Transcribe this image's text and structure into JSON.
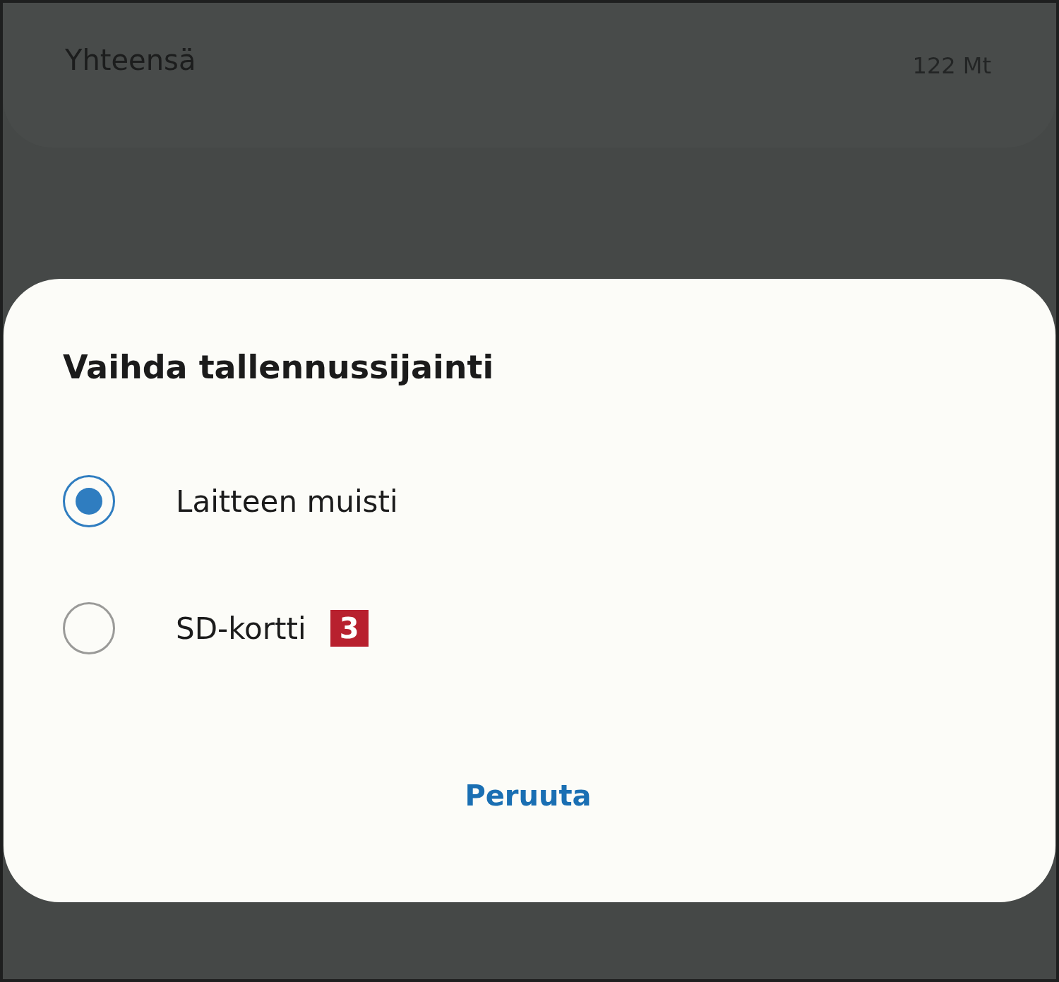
{
  "summary": {
    "label": "Yhteensä",
    "value": "122 Mt"
  },
  "dialog": {
    "title": "Vaihda tallennussijainti",
    "options": [
      {
        "label": "Laitteen muisti",
        "selected": true
      },
      {
        "label": "SD-kortti",
        "selected": false,
        "badge": "3"
      }
    ],
    "buttons": [
      "Peruuta"
    ]
  }
}
